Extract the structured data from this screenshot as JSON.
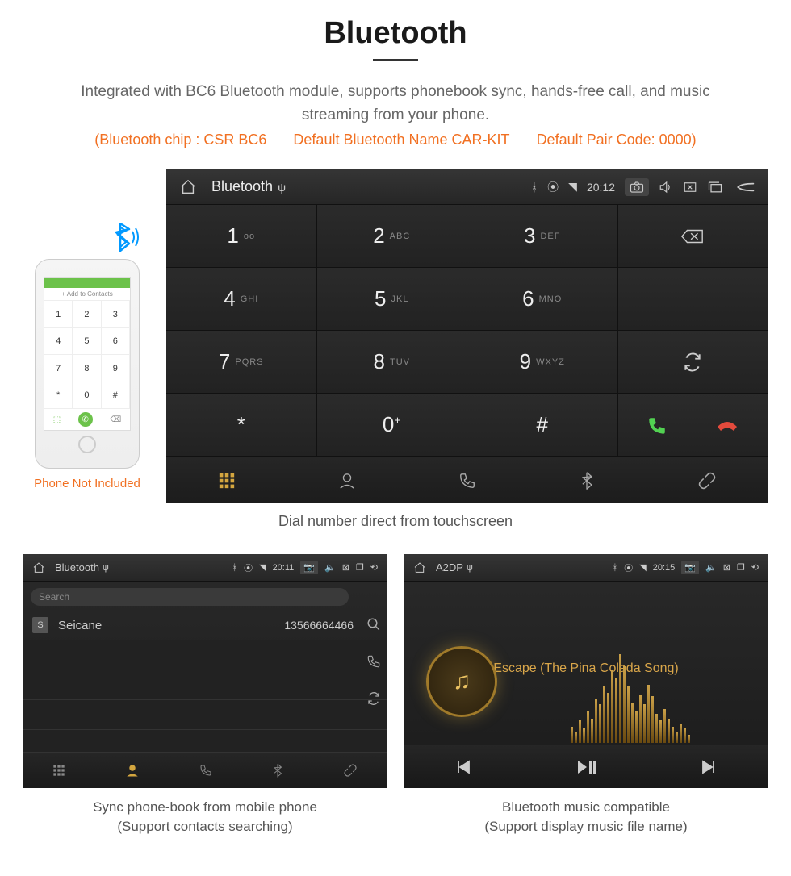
{
  "header": {
    "title": "Bluetooth",
    "description": "Integrated with BC6 Bluetooth module, supports phonebook sync, hands-free call, and music streaming from your phone.",
    "spec_chip": "(Bluetooth chip : CSR BC6",
    "spec_name": "Default Bluetooth Name CAR-KIT",
    "spec_code": "Default Pair Code: 0000)"
  },
  "phone": {
    "add_contacts": "+ Add to Contacts",
    "keys": [
      "1",
      "2",
      "3",
      "4",
      "5",
      "6",
      "7",
      "8",
      "9",
      "*",
      "0",
      "#"
    ],
    "caption": "Phone Not Included"
  },
  "headunit": {
    "topbar": {
      "label": "Bluetooth",
      "time": "20:12"
    },
    "keys": [
      {
        "n": "1",
        "l": "ᴏᴏ"
      },
      {
        "n": "2",
        "l": "ABC"
      },
      {
        "n": "3",
        "l": "DEF"
      },
      {
        "n": "4",
        "l": "GHI"
      },
      {
        "n": "5",
        "l": "JKL"
      },
      {
        "n": "6",
        "l": "MNO"
      },
      {
        "n": "7",
        "l": "PQRS"
      },
      {
        "n": "8",
        "l": "TUV"
      },
      {
        "n": "9",
        "l": "WXYZ"
      },
      {
        "n": "*",
        "l": ""
      },
      {
        "n": "0",
        "l": "+",
        "sup": true
      },
      {
        "n": "#",
        "l": ""
      }
    ],
    "caption": "Dial number direct from touchscreen"
  },
  "phonebook": {
    "topbar": {
      "label": "Bluetooth",
      "time": "20:11"
    },
    "search_placeholder": "Search",
    "contact": {
      "letter": "S",
      "name": "Seicane",
      "number": "13566664466"
    },
    "caption_l1": "Sync phone-book from mobile phone",
    "caption_l2": "(Support contacts searching)"
  },
  "music": {
    "topbar": {
      "label": "A2DP",
      "time": "20:15"
    },
    "track": "Escape (The Pina Colada Song)",
    "caption_l1": "Bluetooth music compatible",
    "caption_l2": "(Support display music file name)",
    "eq_heights": [
      20,
      14,
      28,
      18,
      40,
      30,
      55,
      48,
      70,
      62,
      90,
      80,
      110,
      95,
      70,
      50,
      40,
      60,
      48,
      72,
      58,
      36,
      28,
      42,
      30,
      20,
      14,
      24,
      18,
      10
    ]
  }
}
